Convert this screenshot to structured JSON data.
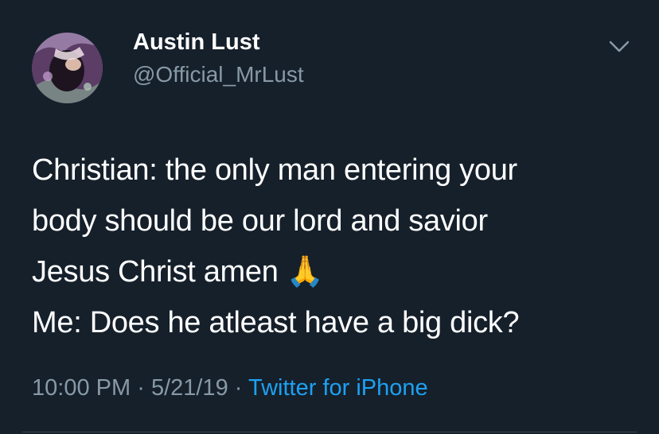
{
  "tweet": {
    "author": {
      "name": "Austin Lust",
      "handle": "@Official_MrLust"
    },
    "lines": [
      "Christian: the only man entering your",
      "body should be our lord and savior",
      "Jesus Christ amen 🙏",
      "Me: Does he atleast have a big dick?"
    ],
    "time": "10:00 PM",
    "date": "5/21/19",
    "separator": "·",
    "source": "Twitter for iPhone"
  },
  "colors": {
    "background": "#15202b",
    "text": "#ffffff",
    "secondary_text": "#8899a6",
    "link": "#1da1f2",
    "divider": "#38444d"
  },
  "icons": {
    "menu": "chevron-down-icon"
  }
}
